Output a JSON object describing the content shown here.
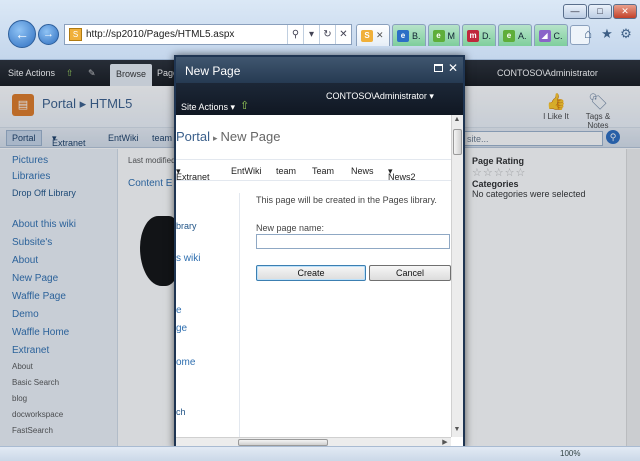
{
  "browser": {
    "url": "http://sp2010/Pages/HTML5.aspx",
    "tabs": [
      {
        "label": "",
        "color": "#f0b03a",
        "icon": "sharepoint-favicon"
      },
      {
        "label": "B.",
        "color": "#2c6fc6",
        "icon": "page-icon"
      },
      {
        "label": "M",
        "color": "#5fae3a",
        "icon": "ie-icon"
      },
      {
        "label": "D.",
        "color": "#c0283c",
        "icon": "m-icon"
      },
      {
        "label": "A.",
        "color": "#5fae3a",
        "icon": "ie-icon"
      },
      {
        "label": "C.",
        "color": "#8a63c9",
        "icon": "chart-icon"
      }
    ]
  },
  "ribbon": {
    "site_actions": "Site Actions",
    "browse": "Browse",
    "page": "Page",
    "user": "CONTOSO\\Administrator"
  },
  "site": {
    "title_portal": "Portal",
    "title_page": "HTML5",
    "i_like_it": "I Like It",
    "tags_notes": "Tags &\nNotes",
    "top_nav": [
      "Portal",
      "Extranet",
      "EntWiki",
      "team"
    ],
    "search_placeholder": "is site...",
    "quick_launch": [
      "Pictures",
      "Libraries",
      "Drop Off Library",
      "About this wiki",
      "Subsite's",
      "About",
      "New Page",
      "Waffle Page",
      "Demo",
      "Waffle Home",
      "Extranet",
      "About",
      "Basic Search",
      "blog",
      "docworkspace",
      "FastSearch"
    ],
    "last_modified": "Last modified",
    "content_editor": "Content E",
    "page_rating": "Page Rating",
    "categories": "Categories",
    "no_categories": "No categories were selected"
  },
  "dialog": {
    "title": "New Page",
    "site_actions": "Site Actions",
    "user": "CONTOSO\\Administrator",
    "crumb_portal": "Portal",
    "crumb_new": "New Page",
    "nav": [
      "Extranet",
      "EntWiki",
      "team",
      "Team",
      "News",
      "News2"
    ],
    "left_items": [
      "brary",
      "s wiki",
      "e",
      "ge",
      "ome",
      "ch"
    ],
    "info": "This page will be created in the Pages library.",
    "name_label": "New page name:",
    "name_value": "",
    "create": "Create",
    "cancel": "Cancel"
  },
  "status": {
    "zoom": "100%"
  }
}
